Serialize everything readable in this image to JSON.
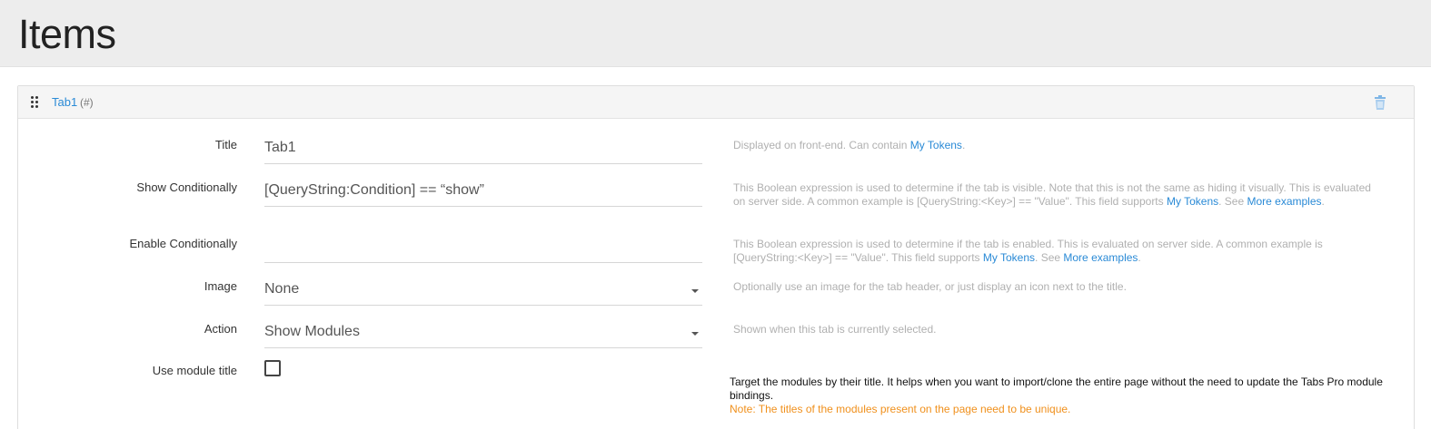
{
  "page": {
    "title": "Items"
  },
  "tab_panel": {
    "name": "Tab1",
    "hash": "(#)"
  },
  "form": {
    "title": {
      "label": "Title",
      "value": "Tab1",
      "help_prefix": "Displayed on front-end. Can contain ",
      "help_link": "My Tokens",
      "help_suffix": "."
    },
    "show_conditionally": {
      "label": "Show Conditionally",
      "value": "[QueryString:Condition] == “show”",
      "help_prefix": "This Boolean expression is used to determine if the tab is visible. Note that this is not the same as hiding it visually. This is evaluated on server side. A common example is [QueryString:<Key>] == \"Value\". This field supports ",
      "help_link1": "My Tokens",
      "help_mid": ". See ",
      "help_link2": "More examples",
      "help_suffix": "."
    },
    "enable_conditionally": {
      "label": "Enable Conditionally",
      "value": "",
      "help_prefix": "This Boolean expression is used to determine if the tab is enabled. This is evaluated on server side. A common example is [QueryString:<Key>] == \"Value\". This field supports ",
      "help_link1": "My Tokens",
      "help_mid": ". See ",
      "help_link2": "More examples",
      "help_suffix": "."
    },
    "image": {
      "label": "Image",
      "value": "None",
      "help": "Optionally use an image for the tab header, or just display an icon next to the title."
    },
    "action": {
      "label": "Action",
      "value": "Show Modules",
      "help": "Shown when this tab is currently selected."
    },
    "use_module_title": {
      "label": "Use module title",
      "checked": false,
      "help": "Target the modules by their title. It helps when you want to import/clone the entire page without the need to update the Tabs Pro module bindings.",
      "note": "Note: The titles of the modules present on the page need to be unique."
    }
  },
  "colors": {
    "link": "#2a8ad6",
    "note": "#f0901c",
    "header_bg": "#ededed"
  },
  "icons": {
    "drag": "drag-handle-icon",
    "delete": "trash-icon",
    "dropdown": "caret-down-icon"
  }
}
